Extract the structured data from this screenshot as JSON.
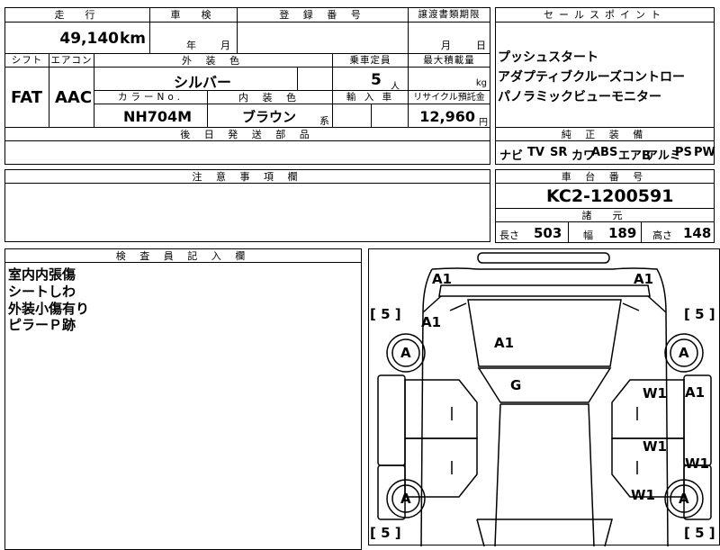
{
  "headers": {
    "mileage": "走　行",
    "inspection": "車　検",
    "registration": "登 録 番 号",
    "transfer_deadline": "譲渡書類期限",
    "sales_points": "セールスポイント",
    "shift": "シフト",
    "aircon": "エアコン",
    "exterior_color": "外 装 色",
    "capacity": "乗車定員",
    "max_load": "最大積載量",
    "color_no": "カラーNo.",
    "interior_color": "内 装 色",
    "import": "輸 入 車",
    "recycle_fee": "リサイクル預託金",
    "later_parts": "後 日 発 送 部 品",
    "genuine_equipment": "純 正 装 備",
    "notes": "注 意 事 項 欄",
    "chassis_number": "車 台 番 号",
    "specs": "諸　元",
    "inspector_notes": "検 査 員 記 入 欄"
  },
  "values": {
    "mileage": "49,140",
    "mileage_unit": "km",
    "inspection_year": "年",
    "inspection_month": "月",
    "transfer_month": "月",
    "transfer_day": "日",
    "shift": "FAT",
    "aircon": "AAC",
    "exterior_color": "シルバー",
    "capacity": "5",
    "capacity_unit": "人",
    "max_load_unit": "kg",
    "color_no": "NH704M",
    "interior_color": "ブラウン",
    "interior_suffix": "系",
    "recycle_fee": "12,960",
    "recycle_unit": "円",
    "chassis_number": "KC2-1200591",
    "length_label": "長さ",
    "length": "503",
    "width_label": "幅",
    "width": "189",
    "height_label": "高さ",
    "height": "148"
  },
  "sales_points": [
    "プッシュスタート",
    "アダプティブクルーズコントロー",
    "パノラミックビューモニター"
  ],
  "equipment": [
    "ナビ",
    "TV",
    "SR",
    "カワ",
    "ABS",
    "エアB",
    "アルミ",
    "PS",
    "PW"
  ],
  "inspector_notes": [
    "室内内張傷",
    "シートしわ",
    "外装小傷有り",
    "ピラーＰ跡"
  ],
  "diagram": {
    "labels": {
      "front_left": "A1",
      "front_right": "A1",
      "left_fender": "A1",
      "hood": "A1",
      "windshield": "G",
      "right_fender": "A1",
      "right_front_door": "W1",
      "right_rear_door": "W1",
      "right_quarter": "W1",
      "right_rocker": "W1",
      "tire_fl": "A",
      "tire_fr": "A",
      "tire_rl": "A",
      "tire_rr": "A"
    },
    "brackets": {
      "fl": "[ 5 ]",
      "fr": "[ 5 ]",
      "rl": "[ 5 ]",
      "rr": "[ 5 ]"
    }
  }
}
